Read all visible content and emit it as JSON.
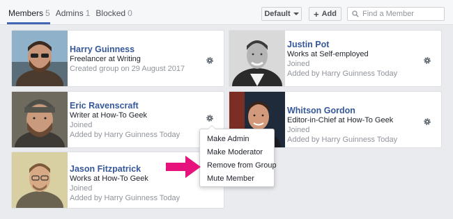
{
  "tabs": [
    {
      "label": "Members",
      "count": "5"
    },
    {
      "label": "Admins",
      "count": "1"
    },
    {
      "label": "Blocked",
      "count": "0"
    }
  ],
  "toolbar": {
    "sort_label": "Default",
    "add_label": "Add",
    "search_placeholder": "Find a Member"
  },
  "members": [
    {
      "name": "Harry Guinness",
      "role": "Freelancer at Writing",
      "line3": "Created group on 29 August 2017"
    },
    {
      "name": "Justin Pot",
      "role": "Works at Self-employed",
      "line3": "Joined",
      "line4": "Added by Harry Guinness Today"
    },
    {
      "name": "Eric Ravenscraft",
      "role": "Writer at How-To Geek",
      "line3": "Joined",
      "line4": "Added by Harry Guinness Today"
    },
    {
      "name": "Whitson Gordon",
      "role": "Editor-in-Chief at How-To Geek",
      "line3": "Joined",
      "line4": "Added by Harry Guinness Today"
    },
    {
      "name": "Jason Fitzpatrick",
      "role": "Works at How-To Geek",
      "line3": "Joined",
      "line4": "Added by Harry Guinness Today"
    }
  ],
  "menu": {
    "items": [
      "Make Admin",
      "Make Moderator",
      "Remove from Group",
      "Mute Member"
    ]
  },
  "icons": {
    "gear": "gear-icon",
    "search": "search-icon",
    "caret": "chevron-down-icon",
    "plus": "plus-icon",
    "arrow": "arrow-right-icon"
  },
  "colors": {
    "link": "#365899",
    "accent": "#4267b2",
    "arrow": "#e8127c"
  }
}
